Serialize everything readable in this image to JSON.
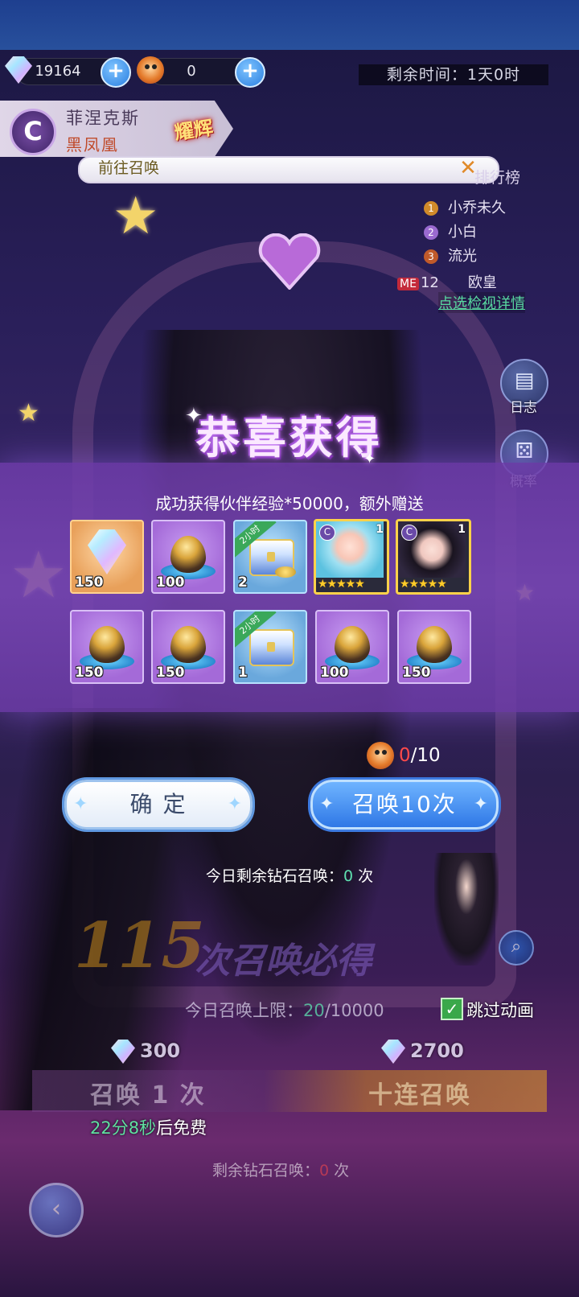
{
  "resources": {
    "gems": "19164",
    "tickets": "0",
    "plus": "+"
  },
  "timer": {
    "label": "剩余时间：1天0时"
  },
  "character": {
    "element_glyph": "C",
    "name": "菲涅克斯",
    "title": "黑凤凰",
    "rank": "耀辉"
  },
  "notice": {
    "text": "前往召唤",
    "close": "✕"
  },
  "leaderboard": {
    "title": "排行榜",
    "entries": [
      {
        "rank": "1",
        "name": "小乔未久",
        "color": "#d08a2a"
      },
      {
        "rank": "2",
        "name": "小白",
        "color": "#9a6ad0"
      },
      {
        "rank": "3",
        "name": "流光",
        "color": "#c05a2a"
      }
    ],
    "me": {
      "tag": "ME",
      "rank": "12",
      "name": "欧皇"
    },
    "detail_link": "点选检视详情"
  },
  "side_buttons": {
    "log": "日志",
    "rate": "概率"
  },
  "popup": {
    "title": "恭喜获得",
    "description": "成功获得伙伴经验*50000，额外赠送",
    "ribbon": "2小时",
    "items_row1": [
      {
        "type": "crystal",
        "qty": "150"
      },
      {
        "type": "egg",
        "qty": "100"
      },
      {
        "type": "chest",
        "qty": "2"
      },
      {
        "type": "portrait-1",
        "qty": "1",
        "stars": "★★★★★"
      },
      {
        "type": "portrait-2",
        "qty": "1",
        "stars": "★★★★★"
      }
    ],
    "items_row2": [
      {
        "type": "egg",
        "qty": "150"
      },
      {
        "type": "egg",
        "qty": "150"
      },
      {
        "type": "chest",
        "qty": "1"
      },
      {
        "type": "egg",
        "qty": "100"
      },
      {
        "type": "egg",
        "qty": "150"
      }
    ],
    "progress_current": "0",
    "progress_total": "/10",
    "confirm_label": "确 定",
    "summon10_label": "召唤10次",
    "today_remaining_prefix": "今日剩余钻石召唤：",
    "today_remaining_value": "0",
    "today_remaining_suffix": " 次"
  },
  "page": {
    "pity_number": "115",
    "pity_text": "次召唤必得",
    "limit_prefix": "今日召唤上限：",
    "limit_value": "20",
    "limit_total": "/10000",
    "skip_label": "跳过动画",
    "cost_single": "300",
    "cost_ten": "2700",
    "summon1": "召唤 1 次",
    "summon10": "十连召唤",
    "free_time": "22分8秒",
    "free_suffix": "后免费",
    "remaining_prefix": "剩余钻石召唤：",
    "remaining_value": "0",
    "remaining_suffix": " 次"
  }
}
